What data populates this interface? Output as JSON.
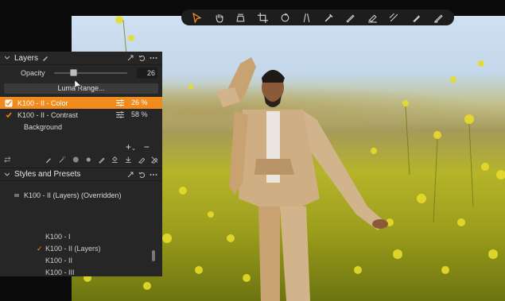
{
  "toolbar": {
    "tools": [
      "select-tool-icon",
      "pan-tool-icon",
      "crop-shape-icon",
      "crop-tool-icon",
      "rotate-tool-icon",
      "keystone-tool-icon",
      "picker-icon",
      "brush-icon",
      "eraser-icon",
      "line-mask-icon",
      "gradient-mask-icon",
      "pen-icon"
    ],
    "active_color": "#f28b1e"
  },
  "layers": {
    "title": "Layers",
    "opacity_label": "Opacity",
    "opacity_value": "26",
    "luma_button": "Luma Range...",
    "items": [
      {
        "name": "K100 - II - Color",
        "value": "26 %",
        "selected": true
      },
      {
        "name": "K100 - II - Contrast",
        "value": "58 %",
        "selected": false
      },
      {
        "name": "Background",
        "value": "",
        "selected": false
      }
    ]
  },
  "styles": {
    "title": "Styles and Presets",
    "override_label": "K100 - II (Layers) (Overridden)",
    "presets": [
      {
        "name": "K100 - I",
        "checked": false
      },
      {
        "name": "K100 - II (Layers)",
        "checked": true
      },
      {
        "name": "K100 - II",
        "checked": false
      },
      {
        "name": "K100 - III",
        "checked": false
      }
    ]
  },
  "colors": {
    "accent": "#f28b1e",
    "panel_bg": "#262626",
    "toolbar_bg": "#1d1d1d"
  }
}
